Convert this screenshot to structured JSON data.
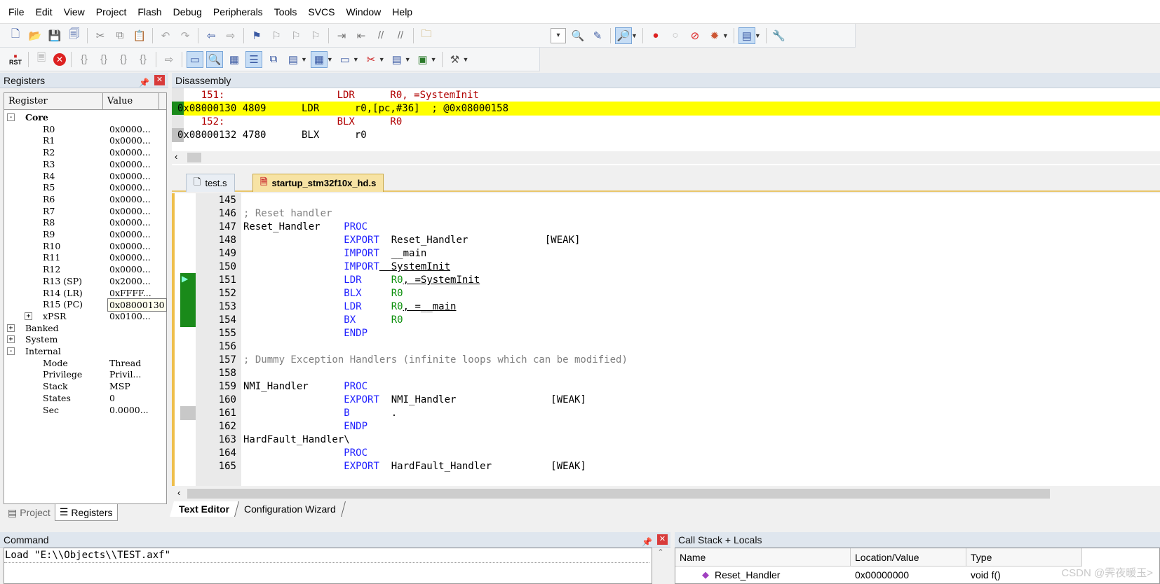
{
  "menu": [
    "File",
    "Edit",
    "View",
    "Project",
    "Flash",
    "Debug",
    "Peripherals",
    "Tools",
    "SVCS",
    "Window",
    "Help"
  ],
  "toolbar": {
    "rst_label": "RST",
    "rst_top": "⏹"
  },
  "registers": {
    "title": "Registers",
    "col_register": "Register",
    "col_value": "Value",
    "groups": {
      "core": "Core",
      "banked": "Banked",
      "system": "System",
      "internal": "Internal"
    },
    "core": [
      {
        "name": "R0",
        "value": "0x0000..."
      },
      {
        "name": "R1",
        "value": "0x0000..."
      },
      {
        "name": "R2",
        "value": "0x0000..."
      },
      {
        "name": "R3",
        "value": "0x0000..."
      },
      {
        "name": "R4",
        "value": "0x0000..."
      },
      {
        "name": "R5",
        "value": "0x0000..."
      },
      {
        "name": "R6",
        "value": "0x0000..."
      },
      {
        "name": "R7",
        "value": "0x0000..."
      },
      {
        "name": "R8",
        "value": "0x0000..."
      },
      {
        "name": "R9",
        "value": "0x0000..."
      },
      {
        "name": "R10",
        "value": "0x0000..."
      },
      {
        "name": "R11",
        "value": "0x0000..."
      },
      {
        "name": "R12",
        "value": "0x0000..."
      },
      {
        "name": "R13 (SP)",
        "value": "0x2000..."
      },
      {
        "name": "R14 (LR)",
        "value": "0xFFFF..."
      },
      {
        "name": "R15 (PC)",
        "value": "0x08000130"
      },
      {
        "name": "xPSR",
        "value": "0x0100..."
      }
    ],
    "internal": [
      {
        "name": "Mode",
        "value": "Thread"
      },
      {
        "name": "Privilege",
        "value": "Privil..."
      },
      {
        "name": "Stack",
        "value": "MSP"
      },
      {
        "name": "States",
        "value": "0"
      },
      {
        "name": "Sec",
        "value": "0.0000..."
      }
    ],
    "tab_project": "Project",
    "tab_registers": "Registers"
  },
  "disassembly": {
    "title": "Disassembly",
    "lines": [
      {
        "text": "    151:                   LDR      R0, =SystemInit",
        "color": "#b00000",
        "highlight": false
      },
      {
        "text": "0x08000130 4809      LDR      r0,[pc,#36]  ; @0x08000158",
        "color": "#000000",
        "highlight": true
      },
      {
        "text": "    152:                   BLX      R0",
        "color": "#b00000",
        "highlight": false
      },
      {
        "text": "0x08000132 4780      BLX      r0",
        "color": "#000000",
        "highlight": false
      }
    ]
  },
  "file_tabs": [
    {
      "label": "test.s",
      "active": false
    },
    {
      "label": "startup_stm32f10x_hd.s",
      "active": true
    }
  ],
  "editor": {
    "lines": [
      {
        "n": "145",
        "segs": []
      },
      {
        "n": "146",
        "segs": [
          {
            "t": "; Reset handler",
            "c": "cm"
          }
        ]
      },
      {
        "n": "147",
        "segs": [
          {
            "t": "Reset_Handler    ",
            "c": "tx"
          },
          {
            "t": "PROC",
            "c": "kw"
          }
        ]
      },
      {
        "n": "148",
        "segs": [
          {
            "t": "                 ",
            "c": "tx"
          },
          {
            "t": "EXPORT",
            "c": "kw"
          },
          {
            "t": "  Reset_Handler             [WEAK]",
            "c": "tx"
          }
        ]
      },
      {
        "n": "149",
        "segs": [
          {
            "t": "                 ",
            "c": "tx"
          },
          {
            "t": "IMPORT",
            "c": "kw"
          },
          {
            "t": "  __main",
            "c": "tx"
          }
        ]
      },
      {
        "n": "150",
        "segs": [
          {
            "t": "                 ",
            "c": "tx"
          },
          {
            "t": "IMPORT",
            "c": "kw"
          },
          {
            "t": "  SystemInit",
            "c": "tx"
          }
        ]
      },
      {
        "n": "151",
        "segs": [
          {
            "t": "                 ",
            "c": "tx"
          },
          {
            "t": "LDR",
            "c": "kw"
          },
          {
            "t": "     ",
            "c": "tx"
          },
          {
            "t": "R0",
            "c": "rg"
          },
          {
            "t": ", =SystemInit",
            "c": "tx"
          }
        ]
      },
      {
        "n": "152",
        "segs": [
          {
            "t": "                 ",
            "c": "tx"
          },
          {
            "t": "BLX",
            "c": "kw"
          },
          {
            "t": "     ",
            "c": "tx"
          },
          {
            "t": "R0",
            "c": "rg"
          }
        ]
      },
      {
        "n": "153",
        "segs": [
          {
            "t": "                 ",
            "c": "tx"
          },
          {
            "t": "LDR",
            "c": "kw"
          },
          {
            "t": "     ",
            "c": "tx"
          },
          {
            "t": "R0",
            "c": "rg"
          },
          {
            "t": ", =__main",
            "c": "tx"
          }
        ]
      },
      {
        "n": "154",
        "segs": [
          {
            "t": "                 ",
            "c": "tx"
          },
          {
            "t": "BX",
            "c": "kw"
          },
          {
            "t": "      ",
            "c": "tx"
          },
          {
            "t": "R0",
            "c": "rg"
          }
        ]
      },
      {
        "n": "155",
        "segs": [
          {
            "t": "                 ",
            "c": "tx"
          },
          {
            "t": "ENDP",
            "c": "kw"
          }
        ]
      },
      {
        "n": "156",
        "segs": []
      },
      {
        "n": "157",
        "segs": [
          {
            "t": "; Dummy Exception Handlers (infinite loops which can be modified)",
            "c": "cm"
          }
        ]
      },
      {
        "n": "158",
        "segs": []
      },
      {
        "n": "159",
        "segs": [
          {
            "t": "NMI_Handler      ",
            "c": "tx"
          },
          {
            "t": "PROC",
            "c": "kw"
          }
        ]
      },
      {
        "n": "160",
        "segs": [
          {
            "t": "                 ",
            "c": "tx"
          },
          {
            "t": "EXPORT",
            "c": "kw"
          },
          {
            "t": "  NMI_Handler                [WEAK]",
            "c": "tx"
          }
        ]
      },
      {
        "n": "161",
        "segs": [
          {
            "t": "                 ",
            "c": "tx"
          },
          {
            "t": "B",
            "c": "kw"
          },
          {
            "t": "       .",
            "c": "tx"
          }
        ]
      },
      {
        "n": "162",
        "segs": [
          {
            "t": "                 ",
            "c": "tx"
          },
          {
            "t": "ENDP",
            "c": "kw"
          }
        ]
      },
      {
        "n": "163",
        "segs": [
          {
            "t": "HardFault_Handler\\",
            "c": "tx"
          }
        ]
      },
      {
        "n": "164",
        "segs": [
          {
            "t": "                 ",
            "c": "tx"
          },
          {
            "t": "PROC",
            "c": "kw"
          }
        ]
      },
      {
        "n": "165",
        "segs": [
          {
            "t": "                 ",
            "c": "tx"
          },
          {
            "t": "EXPORT",
            "c": "kw"
          },
          {
            "t": "  HardFault_Handler          [WEAK]",
            "c": "tx"
          }
        ]
      }
    ],
    "tab_text_editor": "Text Editor",
    "tab_config_wizard": "Configuration Wizard"
  },
  "command": {
    "title": "Command",
    "text": "Load \"E:\\\\Objects\\\\TEST.axf\""
  },
  "callstack": {
    "title": "Call Stack + Locals",
    "col_name": "Name",
    "col_location": "Location/Value",
    "col_type": "Type",
    "row": {
      "name": "Reset_Handler",
      "location": "0x00000000",
      "type": "void f()"
    }
  },
  "watermark": "CSDN @霁夜暖玉>",
  "colors": {
    "highlight": "#ffff00",
    "exec_marker": "#1a8a1a",
    "active_tab": "#f7e3a4"
  }
}
